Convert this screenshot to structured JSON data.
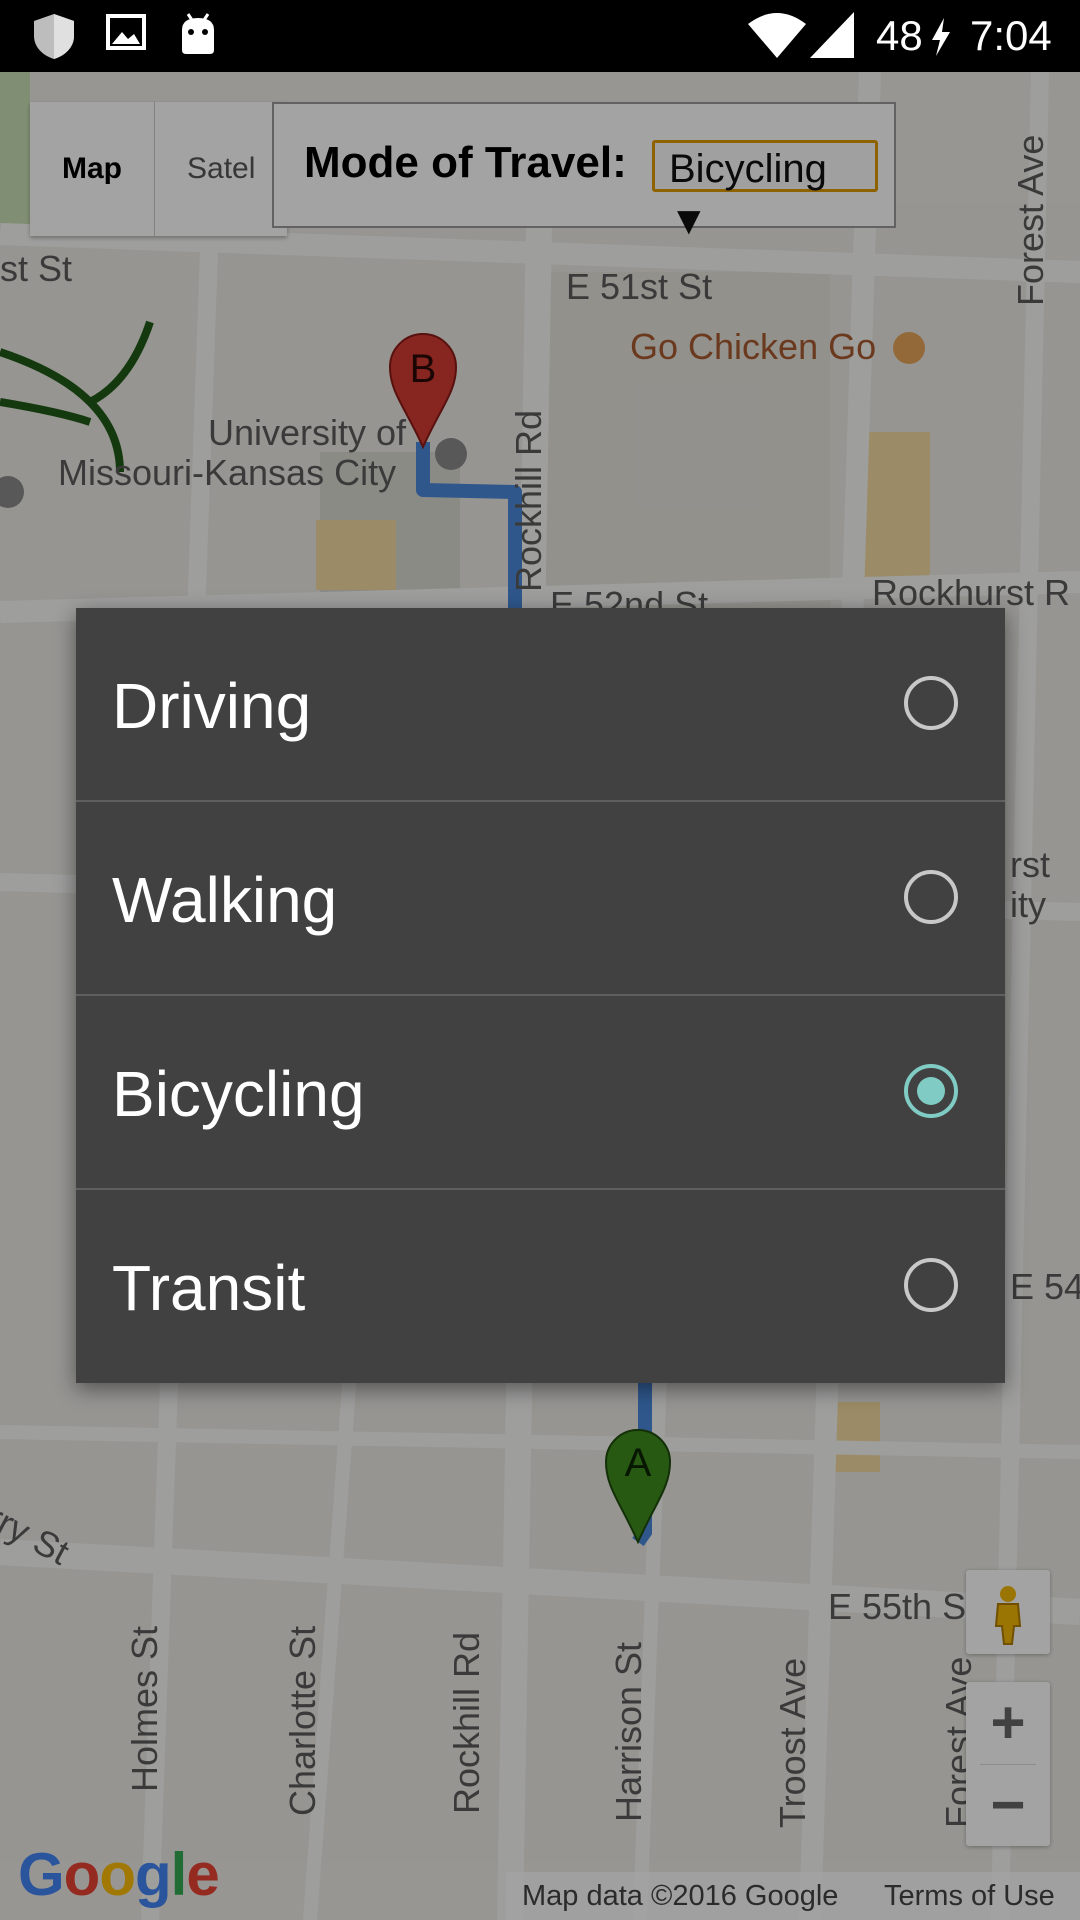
{
  "status_bar": {
    "icons": [
      "shield-icon",
      "image-icon",
      "android-icon",
      "wifi-icon",
      "signal-icon",
      "charging-icon"
    ],
    "battery": "48",
    "time": "7:04"
  },
  "map": {
    "type_control": {
      "map_label": "Map",
      "satellite_label": "Satel"
    },
    "mode_panel": {
      "label": "Mode of Travel:",
      "selected": "Bicycling ▼"
    },
    "labels": {
      "street_st": "st St",
      "e51": "E 51st St",
      "go_chicken": "Go Chicken Go",
      "umkc_line1": "University of",
      "umkc_line2": "Missouri-Kansas City",
      "rockhill_top": "Rockhill Rd",
      "e52": "E 52nd St",
      "rockhurst": "Rockhurst R",
      "forest_top": "Forest Ave",
      "rst": "rst",
      "ity": "ity",
      "e54": "E 54",
      "rry": "rry St",
      "e55": "E 55th S",
      "holmes": "Holmes St",
      "charlotte": "Charlotte St",
      "rockhill_bottom": "Rockhill Rd",
      "harrison": "Harrison St",
      "troost": "Troost Ave",
      "forest_bottom": "Forest Ave"
    },
    "markers": {
      "a": "A",
      "b": "B"
    },
    "zoom": {
      "in": "+",
      "out": "−"
    },
    "google_logo": [
      "G",
      "o",
      "o",
      "g",
      "l",
      "e"
    ],
    "attribution": "Map data ©2016 Google",
    "terms": "Terms of Use",
    "colors": {
      "route": "#4a89dc",
      "marker_a": "#3d8b1f",
      "marker_b": "#d33b32",
      "poi": "#a85a30"
    }
  },
  "dialog": {
    "options": [
      {
        "label": "Driving",
        "checked": false
      },
      {
        "label": "Walking",
        "checked": false
      },
      {
        "label": "Bicycling",
        "checked": true
      },
      {
        "label": "Transit",
        "checked": false
      }
    ],
    "accent_color": "#80cbc4"
  }
}
